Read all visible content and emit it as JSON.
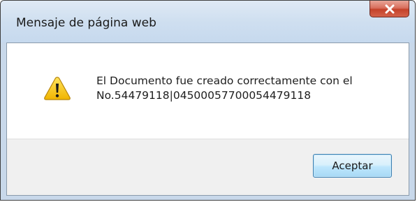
{
  "dialog": {
    "title": "Mensaje de página web",
    "icon": "warning-icon",
    "message_line1": "El Documento fue creado correctamente con el",
    "message_line2": "No.54479118|04500057700054479118",
    "accept_label": "Aceptar",
    "close_icon": "close-icon"
  },
  "colors": {
    "titlebar": "#cfdff0",
    "close_button": "#c4422a",
    "button_area": "#f0f0f0",
    "accept_border": "#3c7fb1",
    "warning_fill": "#f5c400"
  }
}
